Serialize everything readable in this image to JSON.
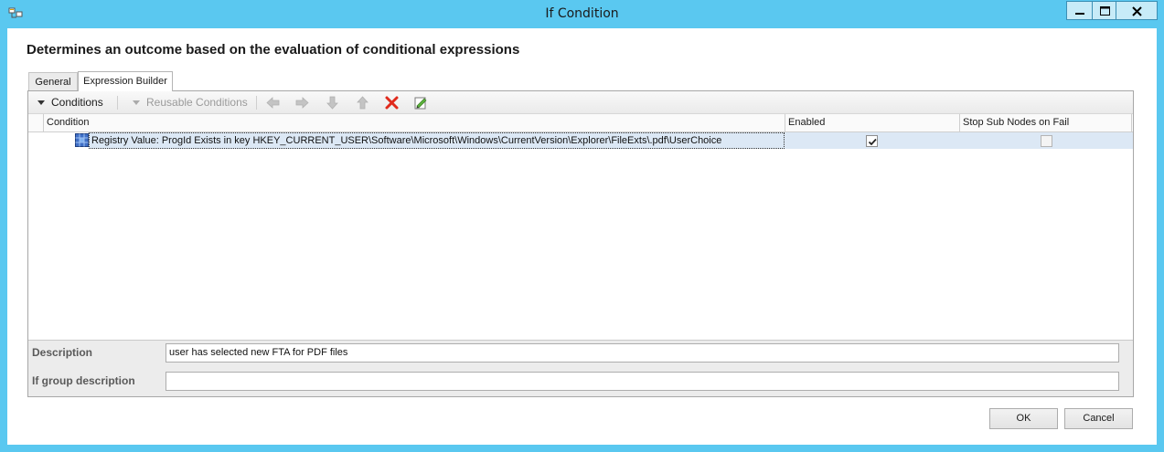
{
  "window": {
    "title": "If Condition",
    "app_icon": "node-icon",
    "controls": [
      "minimize-icon",
      "maximize-icon",
      "close-icon"
    ]
  },
  "heading": "Determines an outcome based on the evaluation of conditional expressions",
  "tabs": [
    {
      "label": "General",
      "active": false
    },
    {
      "label": "Expression Builder",
      "active": true
    }
  ],
  "toolbar": {
    "conditions_label": "Conditions",
    "reusable_label": "Reusable Conditions",
    "icons": [
      "arrow-left-icon",
      "arrow-right-icon",
      "arrow-down-icon",
      "arrow-up-icon",
      "delete-icon",
      "edit-icon"
    ]
  },
  "grid": {
    "columns": [
      "Condition",
      "Enabled",
      "Stop Sub Nodes on Fail"
    ],
    "rows": [
      {
        "condition": "Registry Value: ProgId Exists in key HKEY_CURRENT_USER\\Software\\Microsoft\\Windows\\CurrentVersion\\Explorer\\FileExts\\.pdf\\UserChoice",
        "enabled": true,
        "stop_sub_nodes": false,
        "icon": "registry-icon"
      }
    ]
  },
  "description": {
    "label": "Description",
    "value": "user has selected new FTA for PDF files",
    "group_label": "If group description",
    "group_value": ""
  },
  "buttons": {
    "ok": "OK",
    "cancel": "Cancel"
  },
  "colors": {
    "title_bar": "#5ac8f0",
    "selection": "#dce8f5",
    "delete_red": "#e02a1c"
  }
}
